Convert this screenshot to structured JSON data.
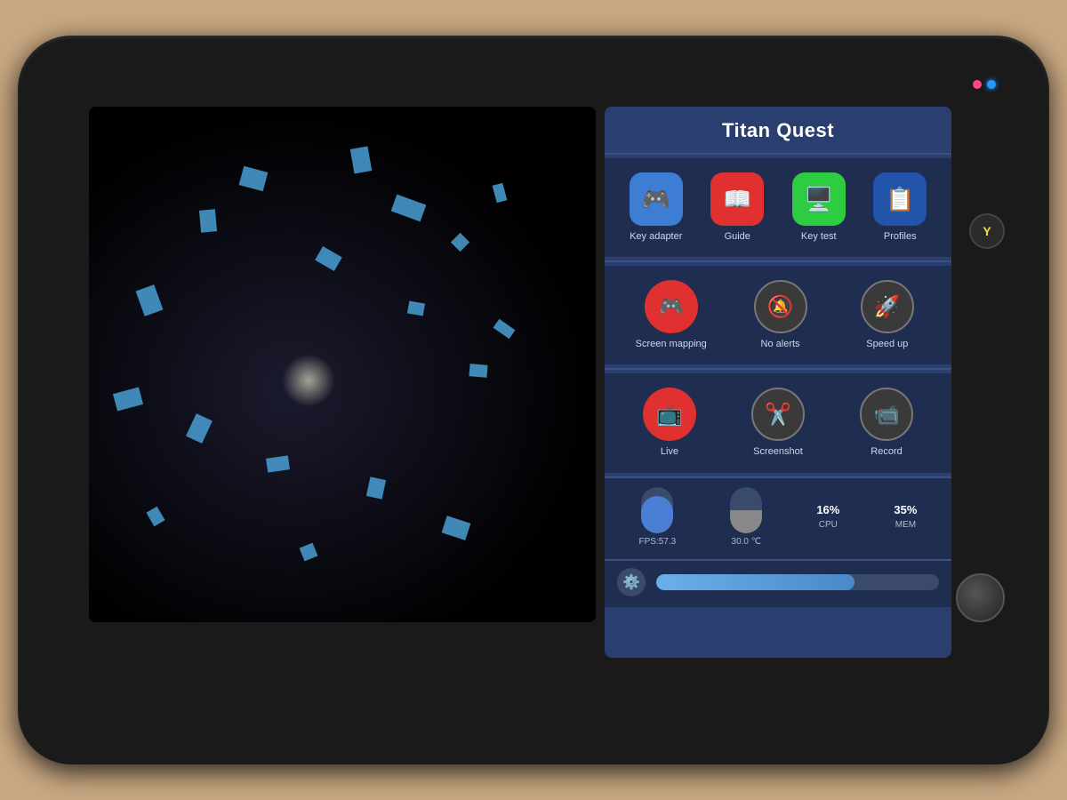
{
  "device": {
    "background_color": "#c8a882"
  },
  "panel": {
    "title": "Titan Quest",
    "sections": {
      "top_icons": [
        {
          "id": "key-adapter",
          "label": "Key adapter",
          "bg": "bg-blue",
          "icon": "🎮"
        },
        {
          "id": "guide",
          "label": "Guide",
          "bg": "bg-red",
          "icon": "📖"
        },
        {
          "id": "key-test",
          "label": "Key test",
          "bg": "bg-green",
          "icon": "🖥️"
        },
        {
          "id": "profiles",
          "label": "Profiles",
          "bg": "bg-darkblue",
          "icon": "📋"
        }
      ],
      "mid_icons": [
        {
          "id": "screen-mapping",
          "label": "Screen mapping",
          "bg": "bg-round-red",
          "icon": "🎮"
        },
        {
          "id": "no-alerts",
          "label": "No alerts",
          "bg": "bg-round-gray",
          "icon": "🔕"
        },
        {
          "id": "speed-up",
          "label": "Speed up",
          "bg": "bg-round-gray",
          "icon": "🚀"
        }
      ],
      "bottom_icons": [
        {
          "id": "live",
          "label": "Live",
          "bg": "bg-round-red",
          "icon": "📺"
        },
        {
          "id": "screenshot",
          "label": "Screenshot",
          "bg": "bg-round-gray",
          "icon": "✂️"
        },
        {
          "id": "record",
          "label": "Record",
          "bg": "bg-round-gray",
          "icon": "📹"
        }
      ]
    },
    "stats": {
      "fps_label": "FPS:57.3",
      "temp_label": "30.0 ℃",
      "cpu_label": "CPU",
      "cpu_value": "16%",
      "mem_label": "MEM",
      "mem_value": "35%"
    },
    "slider": {
      "value": 70
    }
  },
  "controller": {
    "buttons": [
      "Y"
    ]
  }
}
